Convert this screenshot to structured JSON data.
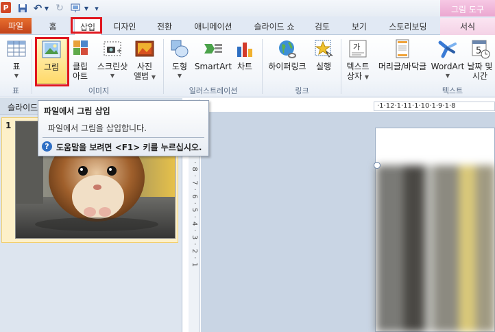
{
  "window": {
    "app_icon": "P",
    "undo_glyph": "↶",
    "redo_glyph": "↻",
    "customize_glyph": "▾"
  },
  "picture_tools": "그림 도구",
  "tabs": [
    {
      "label": "파일"
    },
    {
      "label": "홈"
    },
    {
      "label": "삽입"
    },
    {
      "label": "디자인"
    },
    {
      "label": "전환"
    },
    {
      "label": "애니메이션"
    },
    {
      "label": "슬라이드 쇼"
    },
    {
      "label": "검토"
    },
    {
      "label": "보기"
    },
    {
      "label": "스토리보딩"
    },
    {
      "label": "서식"
    }
  ],
  "ribbon": {
    "table": {
      "label": "표"
    },
    "picture": {
      "label": "그림"
    },
    "clipart": {
      "line1": "클립",
      "line2": "아트"
    },
    "screenshot": {
      "label": "스크린샷"
    },
    "album": {
      "line1": "사진",
      "line2": "앨범"
    },
    "shapes": {
      "label": "도형"
    },
    "smartart": {
      "label": "SmartArt"
    },
    "chart": {
      "label": "차트"
    },
    "hyperlink": {
      "label": "하이퍼링크"
    },
    "action": {
      "label": "실행"
    },
    "textbox": {
      "line1": "텍스트",
      "line2": "상자"
    },
    "headerfooter": {
      "label": "머리글/바닥글"
    },
    "wordart": {
      "label": "WordArt"
    },
    "datetime": {
      "line1": "날짜 및",
      "line2": "시간"
    },
    "groups": {
      "table": "표",
      "images": "이미지",
      "illustrations": "일러스트레이션",
      "links": "링크",
      "text": "텍스트"
    }
  },
  "tooltip": {
    "title": "파일에서 그림 삽입",
    "description": "파일에서 그림을 삽입합니다.",
    "help": "도움말을 보려면 <F1> 키를 누르십시오."
  },
  "pane": {
    "header": "슬라이드",
    "slide_number": "1"
  },
  "ruler": {
    "horizontal": "·1·12·1·11·1·10·1·9·1·8",
    "vertical": "· 8 · 7 · 6 · 5 · 4 · 3 · 2 · 1"
  },
  "colors": {
    "accent_red": "#e0161e",
    "file_tab": "#d24726",
    "picture_tools": "#eaa4cf"
  }
}
